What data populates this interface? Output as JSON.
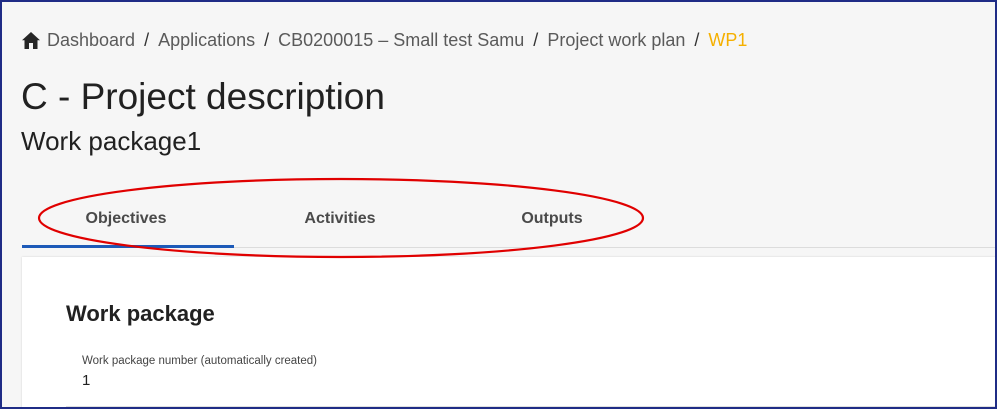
{
  "breadcrumb": {
    "items": [
      "Dashboard",
      "Applications",
      "CB0200015 – Small test Samu",
      "Project work plan"
    ],
    "current": "WP1",
    "separator": "/",
    "home_icon": "home-icon"
  },
  "page": {
    "title": "C - Project description",
    "subtitle": "Work package1"
  },
  "tabs": [
    {
      "label": "Objectives",
      "active": true
    },
    {
      "label": "Activities",
      "active": false
    },
    {
      "label": "Outputs",
      "active": false
    }
  ],
  "section": {
    "title": "Work package",
    "field_label": "Work package number (automatically created)",
    "field_value": "1"
  },
  "colors": {
    "frame": "#1f2c86",
    "breadcrumb_current": "#f5b000",
    "active_tab": "#1d5ab8",
    "annotation": "#e00000"
  }
}
